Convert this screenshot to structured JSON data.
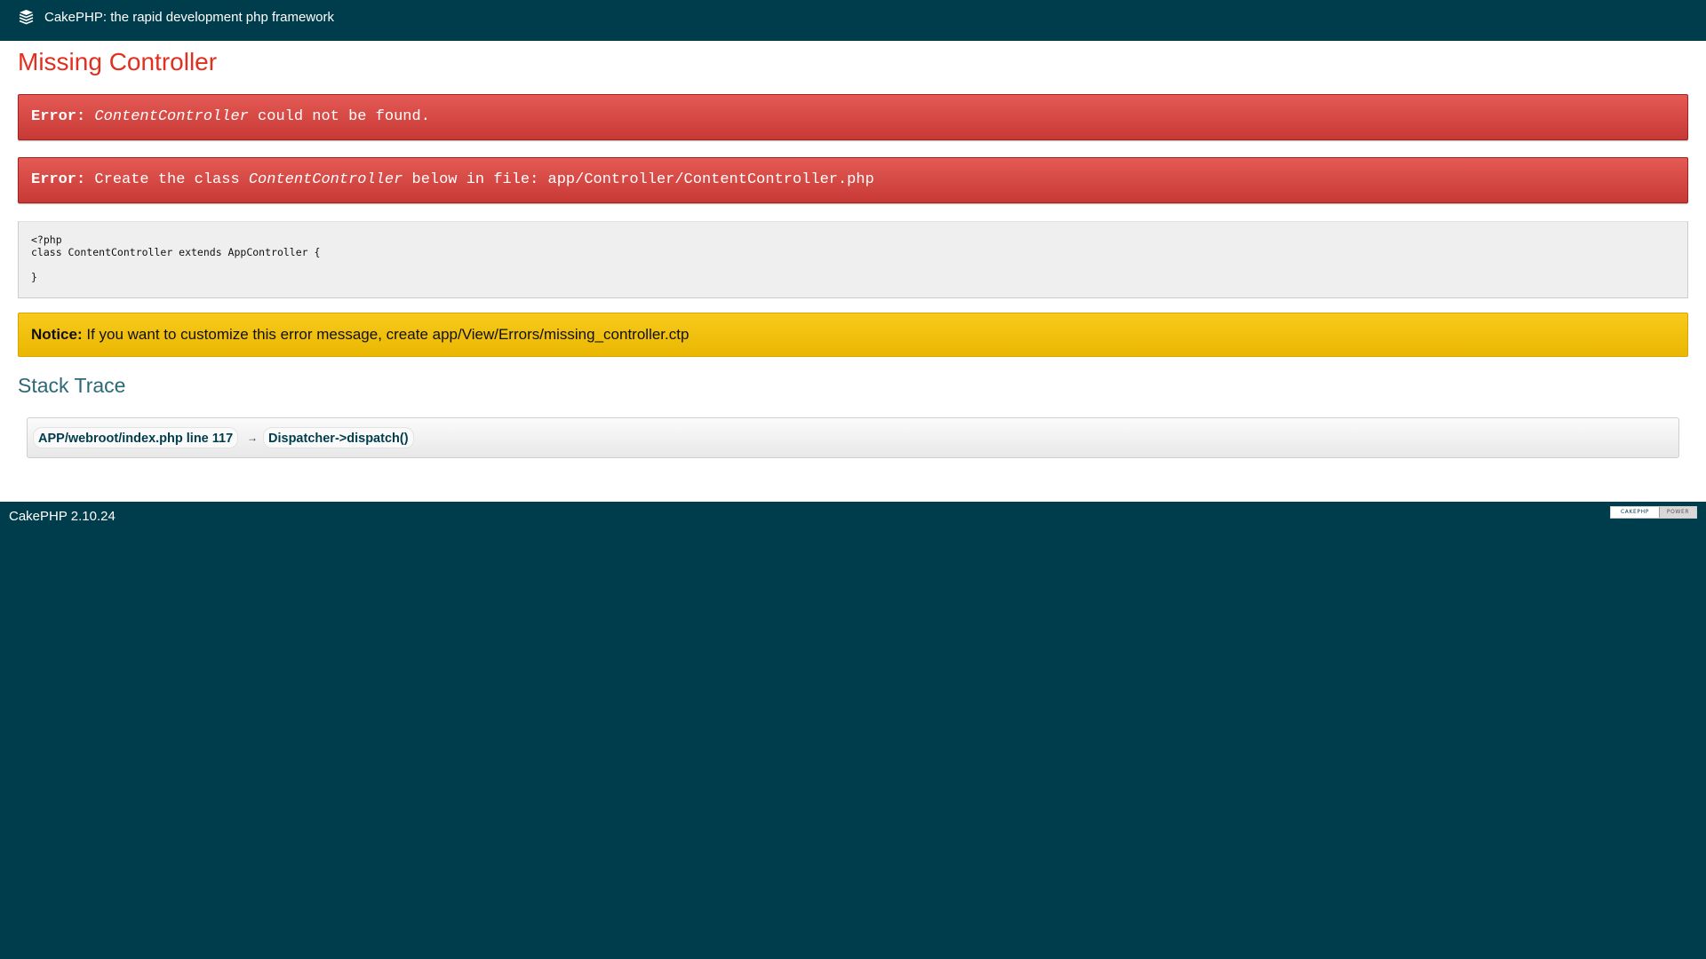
{
  "header": {
    "title": "CakePHP: the rapid development php framework",
    "logo_icon": "cakephp-logo-icon"
  },
  "page": {
    "title": "Missing Controller"
  },
  "errors": [
    {
      "label": "Error:",
      "class_name": "ContentController",
      "text_after": " could not be found."
    },
    {
      "label": "Error:",
      "text_before": " Create the class ",
      "class_name": "ContentController",
      "text_after": " below in file: app/Controller/ContentController.php"
    }
  ],
  "code": {
    "content": "<?php\nclass ContentController extends AppController {\n\n}"
  },
  "notice": {
    "label": "Notice:",
    "text": " If you want to customize this error message, create app/View/Errors/missing_controller.ctp"
  },
  "stack_trace": {
    "title": "Stack Trace",
    "frames": [
      {
        "label": "APP/webroot/index.php line 117"
      },
      {
        "label": "Dispatcher->dispatch()"
      }
    ],
    "separator": "→"
  },
  "footer": {
    "version": "CakePHP 2.10.24",
    "powered_left": "CAKEPHP",
    "powered_right": "POWER"
  },
  "colors": {
    "brand_dark": "#003d4c",
    "error_red": "#c73934",
    "title_red": "#e32f1f",
    "notice_yellow": "#f1bf0b",
    "stack_title": "#2c6877"
  }
}
